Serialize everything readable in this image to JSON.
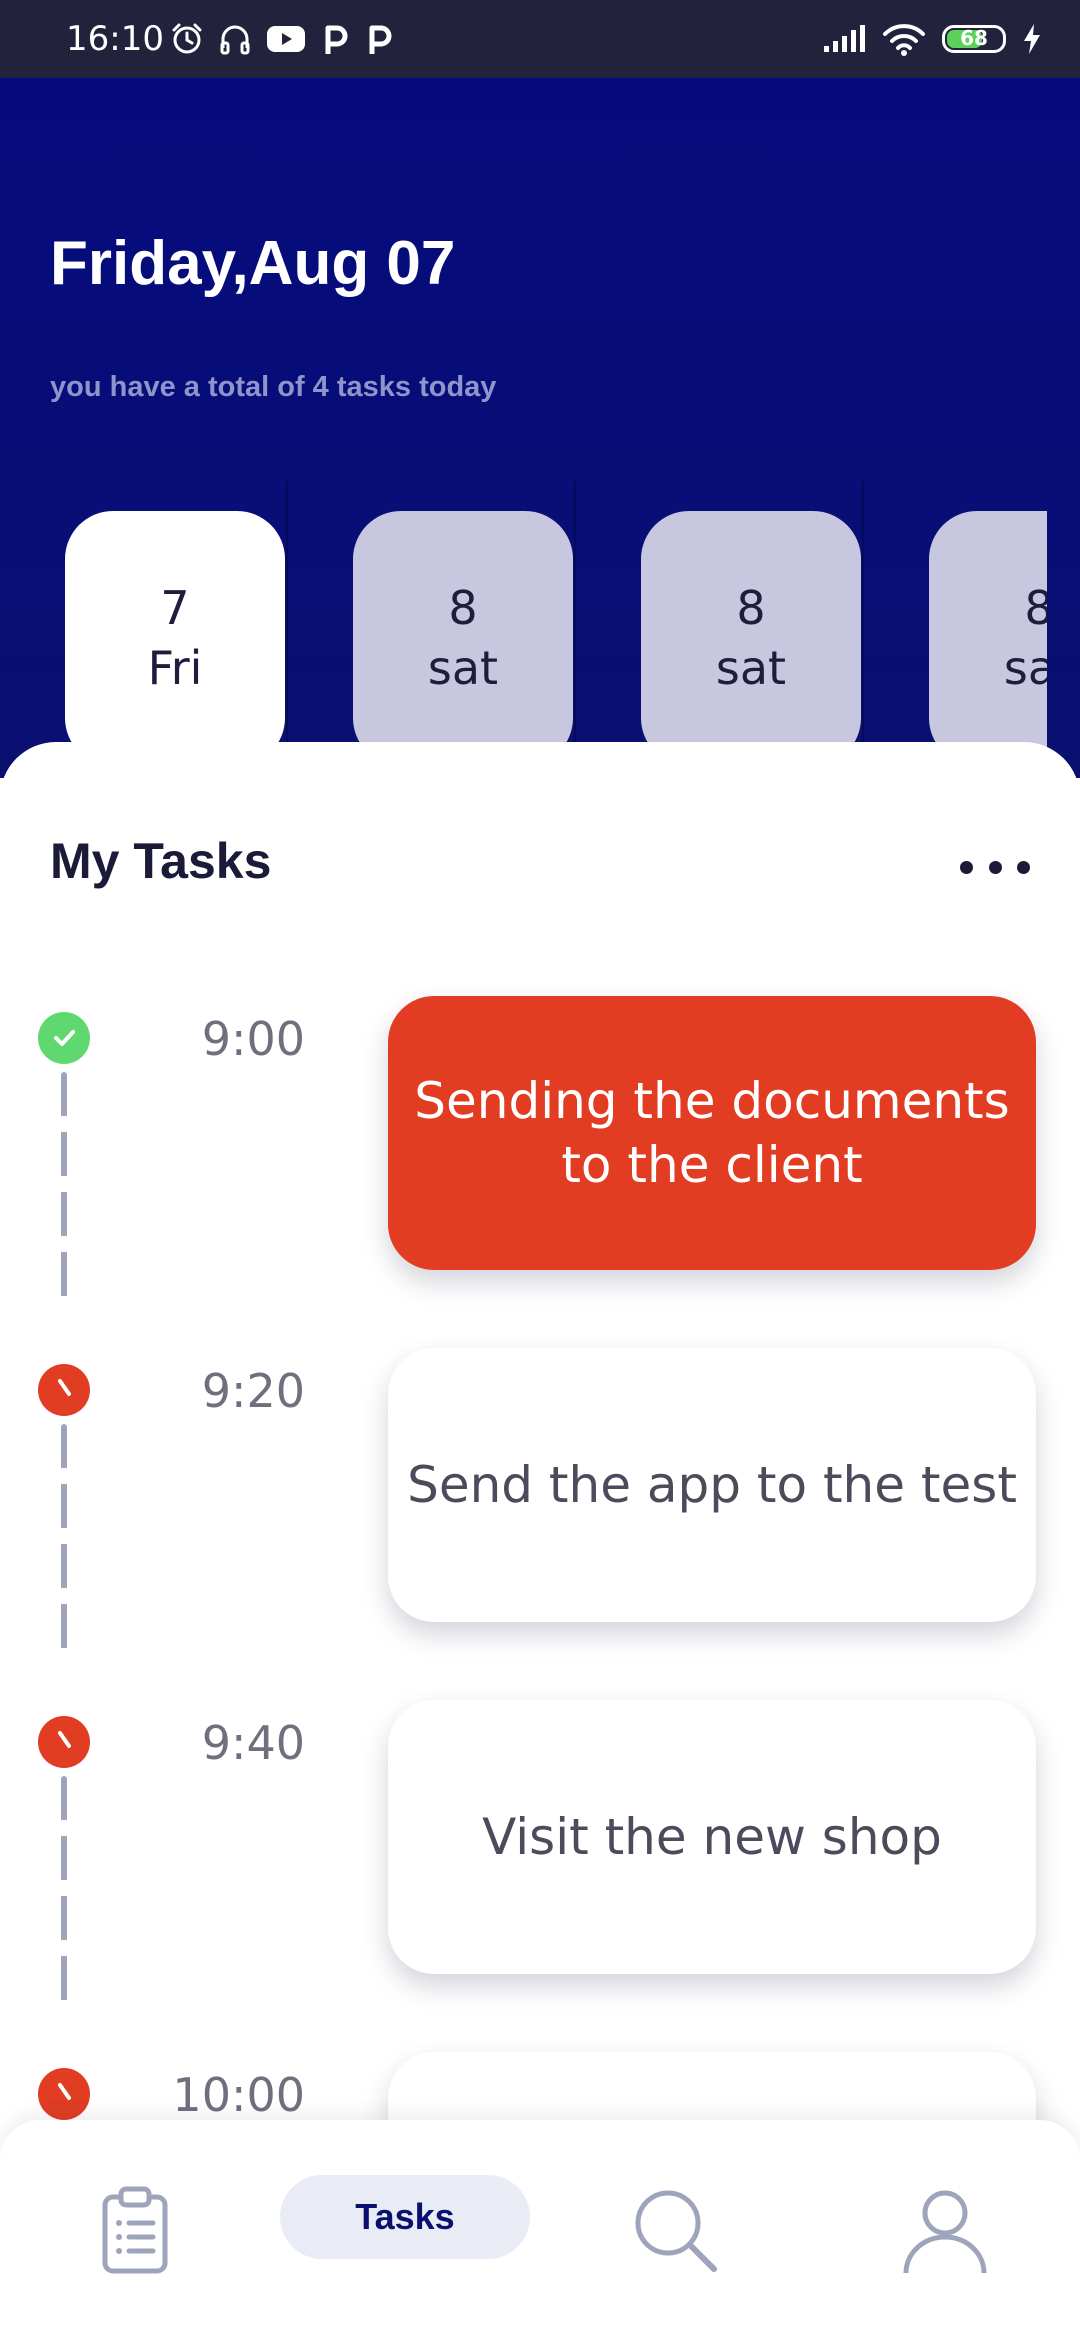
{
  "status_bar": {
    "time": "16:10",
    "battery_level": "68",
    "battery_fraction": 0.68
  },
  "header": {
    "date_title": "Friday,Aug 07",
    "task_summary": "you have a total of 4 tasks today"
  },
  "days": [
    {
      "number": "7",
      "weekday": "Fri",
      "active": true
    },
    {
      "number": "8",
      "weekday": "sat",
      "active": false
    },
    {
      "number": "8",
      "weekday": "sat",
      "active": false
    },
    {
      "number": "8",
      "weekday": "sat",
      "active": false
    }
  ],
  "tasks_section": {
    "title": "My Tasks"
  },
  "tasks": [
    {
      "time": "9:00",
      "title": "Sending the documents to the client",
      "status": "done"
    },
    {
      "time": "9:20",
      "title": "Send the app to the test",
      "status": "pending"
    },
    {
      "time": "9:40",
      "title": "Visit the new shop",
      "status": "pending"
    },
    {
      "time": "10:00",
      "title": "",
      "status": "pending"
    }
  ],
  "bottom_nav": {
    "tasks_label": "Tasks"
  },
  "colors": {
    "header_blue": "#050b7e",
    "accent_red": "#e23d22",
    "done_green": "#5fd86f",
    "card_inactive": "#c7c8e0"
  }
}
